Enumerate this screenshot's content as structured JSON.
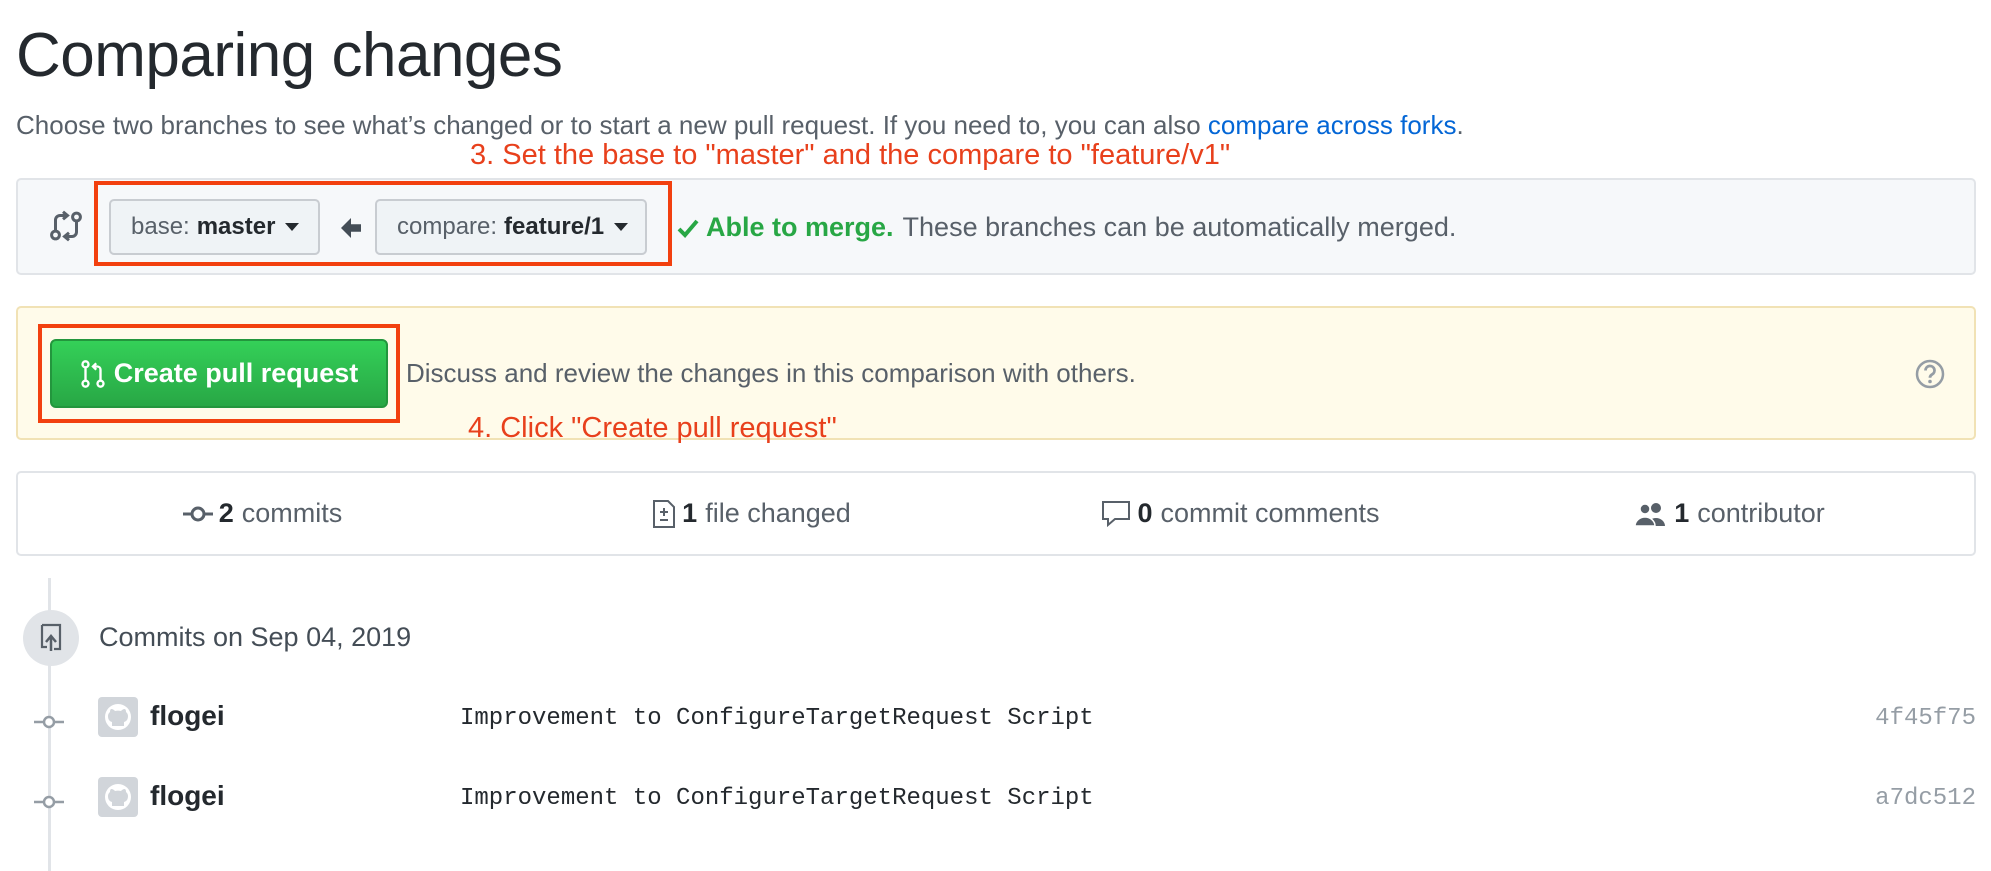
{
  "page": {
    "title": "Comparing changes",
    "subtitle_text": "Choose two branches to see what’s changed or to start a new pull request. If you need to, you can also ",
    "subtitle_link": "compare across forks",
    "subtitle_end": "."
  },
  "annotations": {
    "step3": "3. Set the base to \"master\" and the compare to \"feature/v1\"",
    "step4": "4. Click \"Create pull request\""
  },
  "range_editor": {
    "base_prefix": "base:",
    "base_branch": "master",
    "compare_prefix": "compare:",
    "compare_branch": "feature/1",
    "merge_ok": "Able to merge.",
    "merge_text": "These branches can be automatically merged."
  },
  "pull_request": {
    "button_label": "Create pull request",
    "description": "Discuss and review the changes in this comparison with others."
  },
  "summary": {
    "commits_count": "2",
    "commits_label": "commits",
    "files_count": "1",
    "files_label": "file changed",
    "comments_count": "0",
    "comments_label": "commit comments",
    "contributors_count": "1",
    "contributors_label": "contributor"
  },
  "commits_group": {
    "title": "Commits on Sep 04, 2019",
    "commits": [
      {
        "author": "flogei",
        "message": "Improvement to ConfigureTargetRequest Script",
        "sha": "4f45f75"
      },
      {
        "author": "flogei",
        "message": "Improvement to ConfigureTargetRequest Script",
        "sha": "a7dc512"
      }
    ]
  },
  "colors": {
    "annotation": "#e8401c",
    "merge_ok": "#28a745",
    "link": "#0366d6",
    "pr_button": "#2cbe4e"
  },
  "icons": [
    "git-compare-icon",
    "arrow-left-icon",
    "check-icon",
    "git-pull-request-icon",
    "question-icon",
    "git-commit-icon",
    "file-diff-icon",
    "comment-icon",
    "people-icon",
    "repo-push-icon",
    "github-avatar-icon"
  ]
}
